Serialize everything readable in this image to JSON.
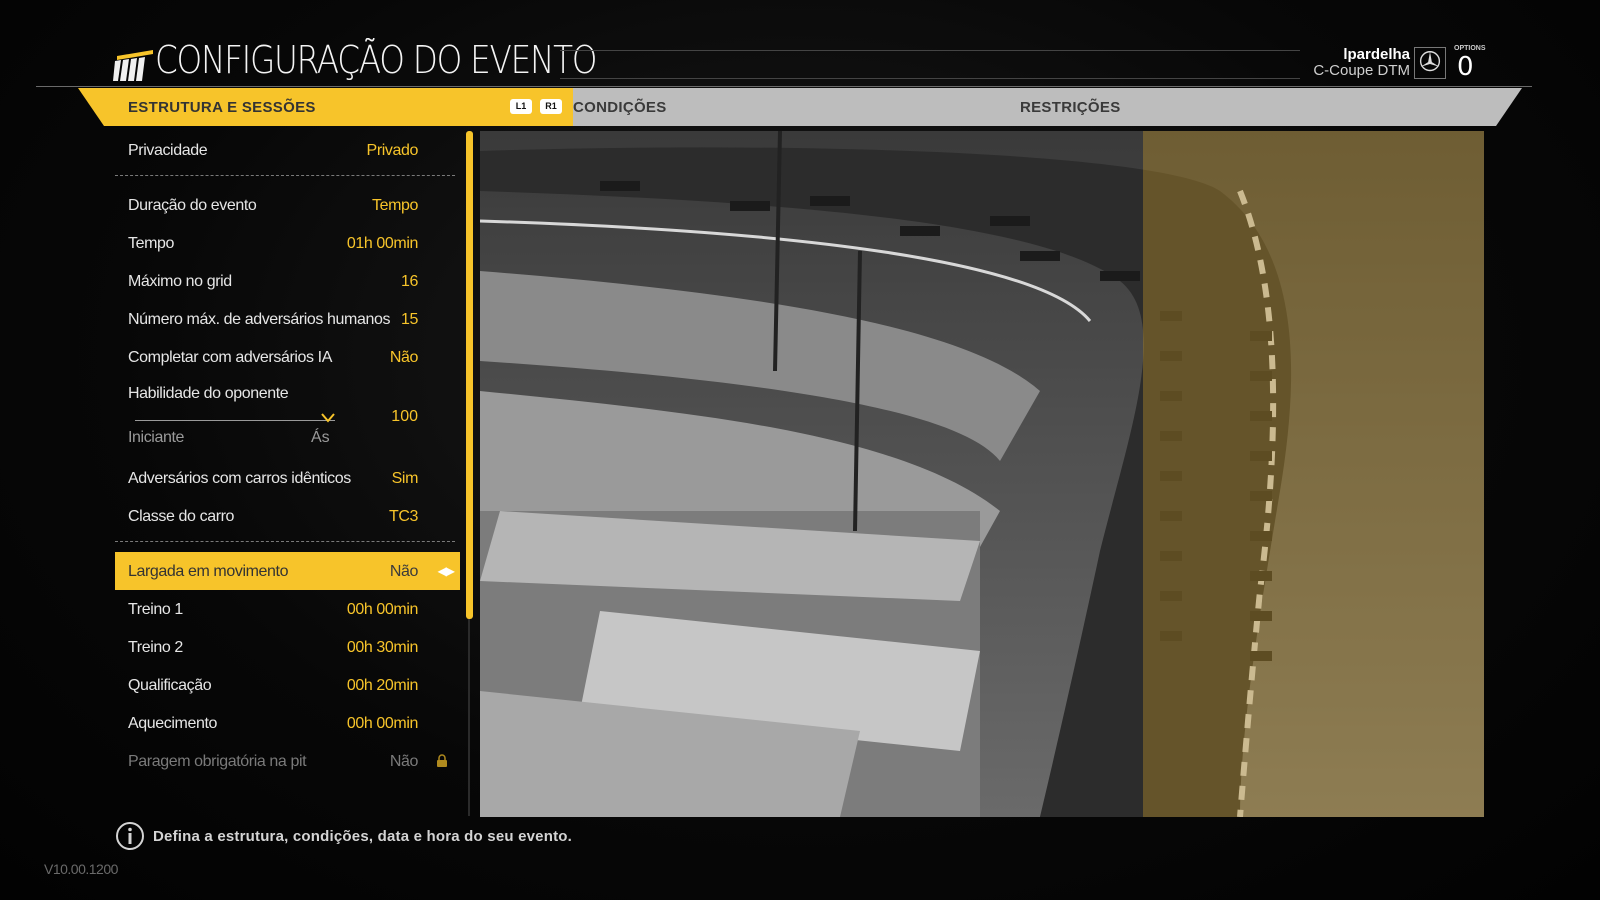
{
  "header": {
    "title": "CONFIGURAÇÃO DO EVENTO",
    "user_name": "lpardelha",
    "car_name": "C-Coupe DTM",
    "options_label": "OPTIONS",
    "notification_count": "0"
  },
  "tabs": {
    "active": "ESTRUTURA E SESSÕES",
    "l1_label": "L1",
    "r1_label": "R1",
    "conditions": "CONDIÇÕES",
    "restrictions": "RESTRIÇÕES"
  },
  "settings": {
    "privacy": {
      "label": "Privacidade",
      "value": "Privado"
    },
    "duration": {
      "label": "Duração do evento",
      "value": "Tempo"
    },
    "time": {
      "label": "Tempo",
      "value": "01h 00min"
    },
    "max_grid": {
      "label": "Máximo no grid",
      "value": "16"
    },
    "max_humans": {
      "label": "Número máx. de adversários humanos",
      "value": "15"
    },
    "fill_ai": {
      "label": "Completar com adversários IA",
      "value": "Não"
    },
    "skill": {
      "label": "Habilidade do oponente",
      "value": "100",
      "min_label": "Iniciante",
      "max_label": "Ás",
      "level": 1.0
    },
    "identical_cars": {
      "label": "Adversários com carros idênticos",
      "value": "Sim"
    },
    "car_class": {
      "label": "Classe do carro",
      "value": "TC3"
    },
    "rolling_start": {
      "label": "Largada em movimento",
      "value": "Não"
    },
    "practice1": {
      "label": "Treino 1",
      "value": "00h 00min"
    },
    "practice2": {
      "label": "Treino 2",
      "value": "00h 30min"
    },
    "qualifying": {
      "label": "Qualificação",
      "value": "00h 20min"
    },
    "warmup": {
      "label": "Aquecimento",
      "value": "00h 00min"
    },
    "pit_stop": {
      "label": "Paragem obrigatória na pit",
      "value": "Não"
    }
  },
  "footer": {
    "hint": "Defina a estrutura, condições, data e hora do seu evento.",
    "version": "V10.00.1200"
  },
  "colors": {
    "accent": "#f7c42a",
    "tab_inactive": "#bdbdbd",
    "background": "#050505"
  }
}
